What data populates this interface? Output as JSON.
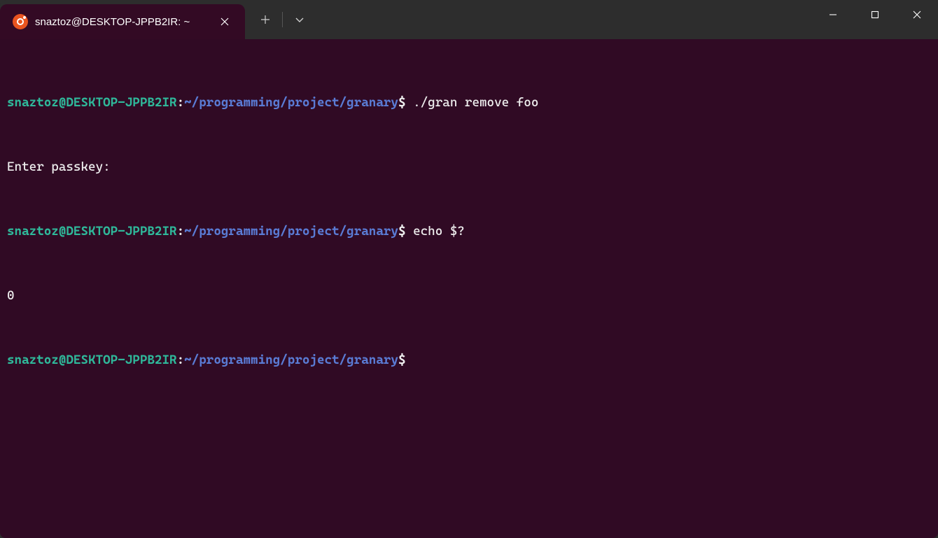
{
  "window": {
    "tab_title": "snaztoz@DESKTOP-JPPB2IR: ~",
    "icons": {
      "tab": "ubuntu-icon",
      "close_tab": "close-icon",
      "new_tab": "plus-icon",
      "dropdown": "chevron-down-icon",
      "minimize": "minimize-icon",
      "maximize": "maximize-icon",
      "close": "close-icon"
    }
  },
  "colors": {
    "terminal_bg": "#300a24",
    "titlebar_bg": "#2d2d2d",
    "user_host": "#2fb89a",
    "path": "#5a7bd4",
    "text": "#eeeeee",
    "ubuntu_orange": "#E95420"
  },
  "terminal": {
    "lines": [
      {
        "type": "prompt",
        "user_host": "snaztoz@DESKTOP-JPPB2IR",
        "colon": ":",
        "path": "~/programming/project/granary",
        "dollar": "$",
        "command": " ./gran remove foo"
      },
      {
        "type": "output",
        "text": "Enter passkey:"
      },
      {
        "type": "prompt",
        "user_host": "snaztoz@DESKTOP-JPPB2IR",
        "colon": ":",
        "path": "~/programming/project/granary",
        "dollar": "$",
        "command": " echo $?"
      },
      {
        "type": "output",
        "text": "0"
      },
      {
        "type": "prompt",
        "user_host": "snaztoz@DESKTOP-JPPB2IR",
        "colon": ":",
        "path": "~/programming/project/granary",
        "dollar": "$",
        "command": ""
      }
    ]
  }
}
